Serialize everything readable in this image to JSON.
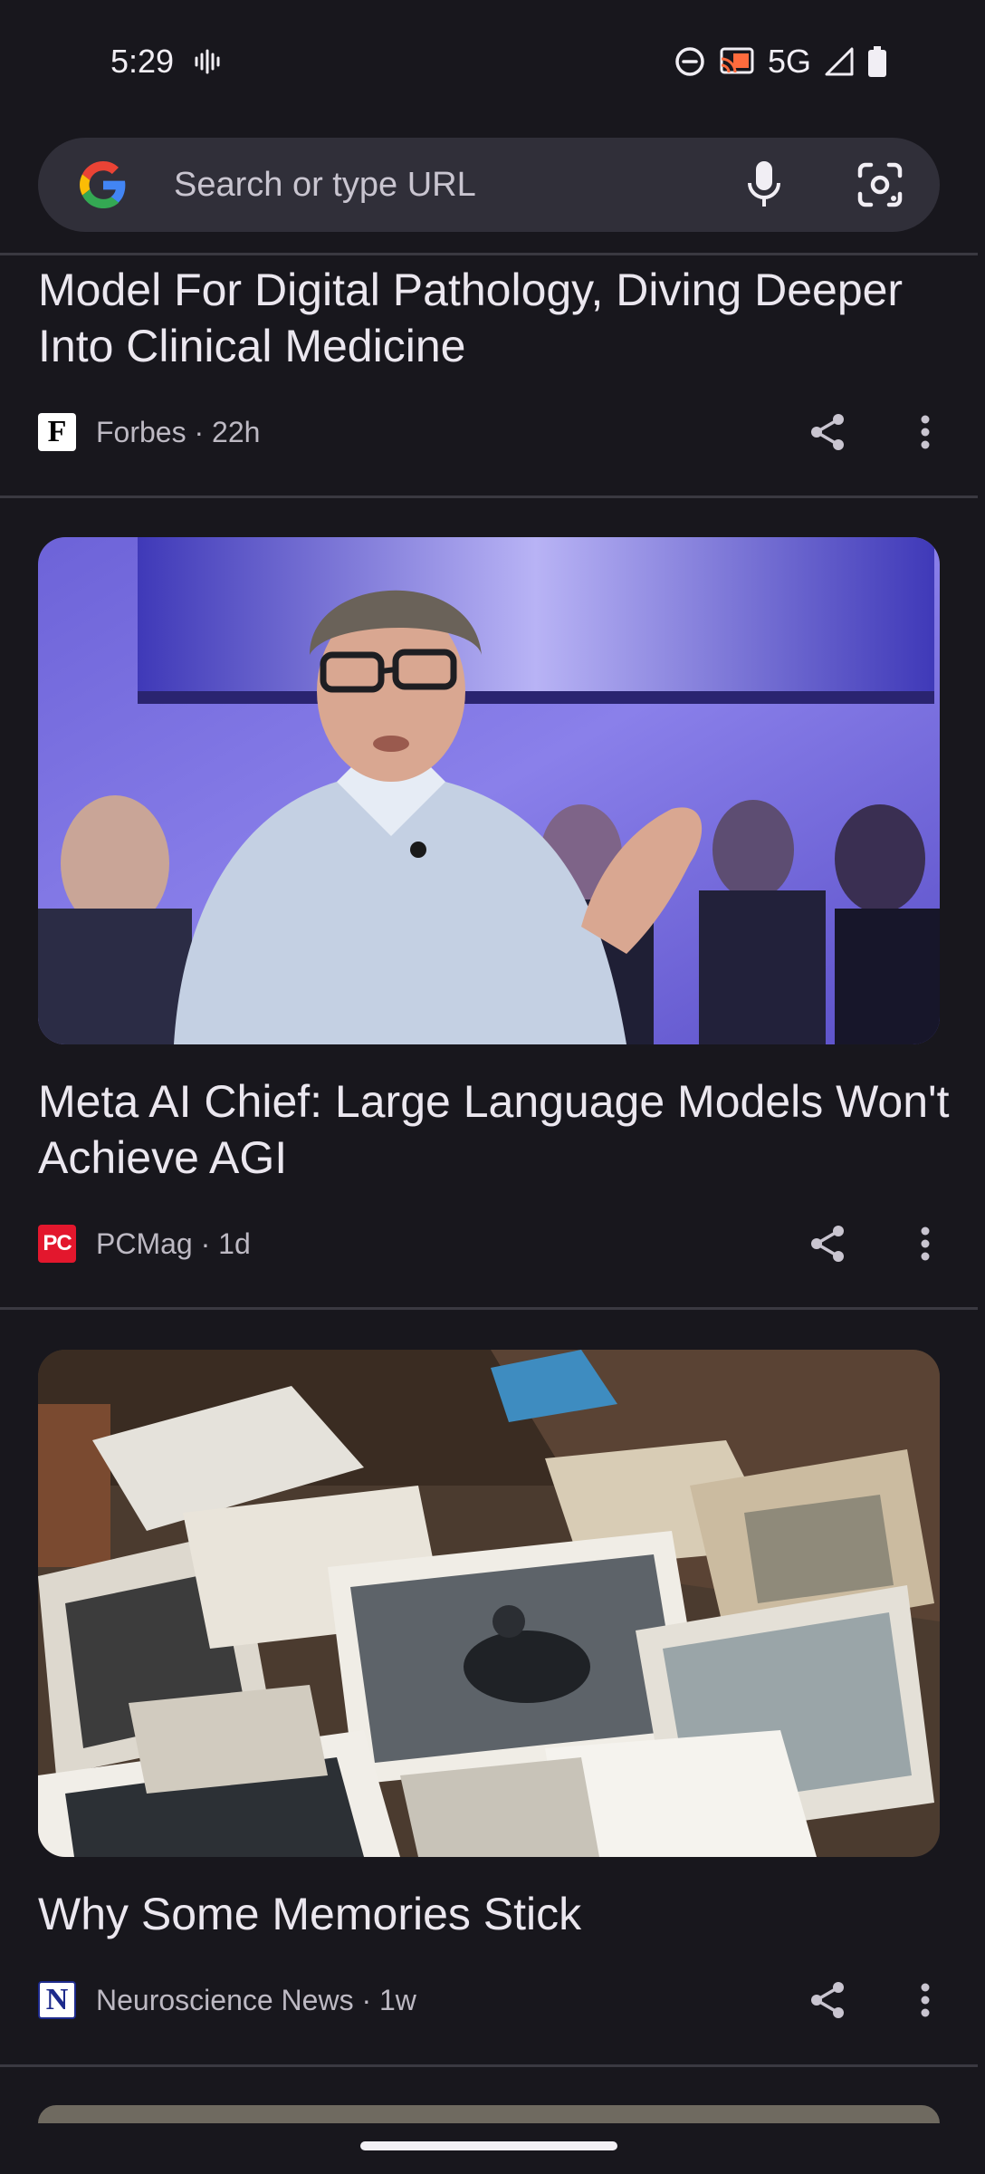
{
  "status_bar": {
    "time": "5:29",
    "network": "5G",
    "icons": [
      "vibrate-icon",
      "dnd-icon",
      "cast-icon",
      "signal-icon",
      "battery-icon"
    ]
  },
  "search": {
    "placeholder": "Search or type URL",
    "icons": [
      "google-logo-icon",
      "mic-icon",
      "lens-icon"
    ]
  },
  "articles": [
    {
      "title": "Model For Digital Pathology, Diving Deeper Into Clinical Medicine",
      "source": "Forbes",
      "age": "22h",
      "meta": "Forbes · 22h",
      "logo_text": "F"
    },
    {
      "title": "Meta AI Chief: Large Language Models Won't Achieve AGI",
      "source": "PCMag",
      "age": "1d",
      "meta": "PCMag · 1d",
      "logo_text": "PC",
      "image": "man-speaking-on-stage-photo"
    },
    {
      "title": "Why Some Memories Stick",
      "source": "Neuroscience News",
      "age": "1w",
      "meta": "Neuroscience News · 1w",
      "logo_text": "N",
      "image": "pile-of-old-photographs"
    }
  ],
  "colors": {
    "background": "#18171d",
    "search_bg": "#302f39",
    "pcmag_red": "#e3172d",
    "neuro_blue": "#1d2a8c"
  }
}
